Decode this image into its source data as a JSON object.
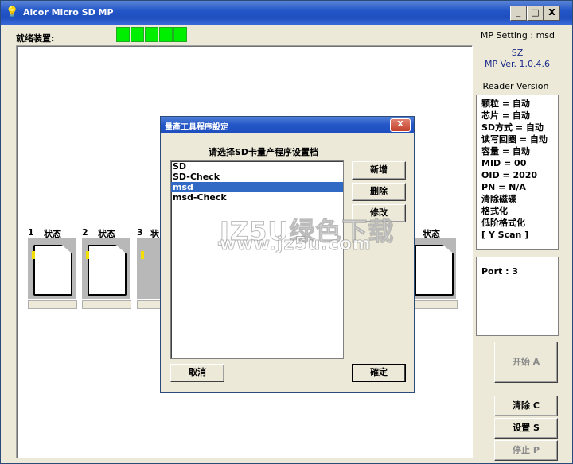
{
  "window": {
    "title": "Alcor Micro SD MP",
    "controls": {
      "minimize": "_",
      "maximize": "□",
      "close": "X"
    }
  },
  "ready_label": "就绪装置:",
  "ready_indicator_count": 5,
  "slots": [
    {
      "num": "1",
      "label": "状态"
    },
    {
      "num": "2",
      "label": "状态"
    },
    {
      "num": "3",
      "label": "状"
    },
    {
      "num": "",
      "label": "状态"
    }
  ],
  "right_panel": {
    "mp_setting": "MP Setting : msd",
    "vendor": "SZ",
    "mp_version": "MP Ver. 1.0.4.6",
    "reader_version_label": "Reader Version",
    "info_lines": [
      "颗粒 = 自动",
      "芯片 = 自动",
      "SD方式 = 自动",
      "读写回圈 = 自动",
      "容量 = 自动",
      "MID = 00",
      "OID = 2020",
      "PN = N/A",
      "清除磁碟",
      "格式化",
      "低阶格式化",
      "[ Y Scan ]"
    ],
    "port_label": "Port : 3",
    "buttons": {
      "start": "开始 A",
      "clear": "清除 C",
      "settings": "设置 S",
      "stop": "停止 P"
    }
  },
  "dialog": {
    "title": "量產工具程序設定",
    "close": "X",
    "prompt": "请选择SD卡量产程序设置档",
    "list_items": [
      "SD",
      "SD-Check",
      "msd",
      "msd-Check"
    ],
    "selected_index": 2,
    "buttons": {
      "new": "新增",
      "delete": "删除",
      "edit": "修改",
      "cancel": "取消",
      "ok": "確定"
    }
  },
  "watermark": {
    "line1": "JZ5U绿色下载",
    "line2": "www.jz5u.com"
  },
  "colors": {
    "titlebar": "#2456c8",
    "ready_green": "#00ee00",
    "selection": "#316ac5",
    "version_text": "#1c2a8a"
  }
}
